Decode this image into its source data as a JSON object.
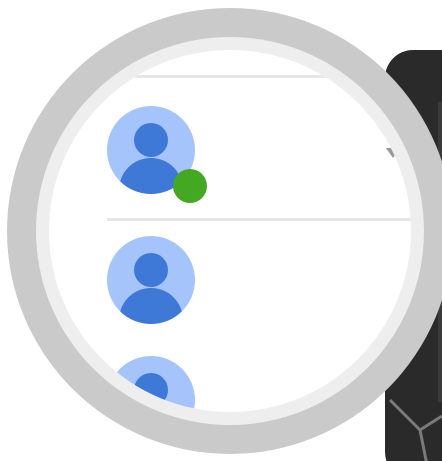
{
  "icons": {
    "avatar": "person-avatar-icon",
    "status": "online-status-icon",
    "chevron": "chevron-down-icon"
  },
  "colors": {
    "avatar_bg": "#a5c4fb",
    "avatar_fg": "#3e79d8",
    "online_status": "#44a823",
    "lens_ring": "#cacaca",
    "device": "#2a2a2a"
  },
  "contacts": [
    {
      "status": "online"
    },
    {
      "status": "none"
    },
    {
      "status": "none"
    }
  ]
}
